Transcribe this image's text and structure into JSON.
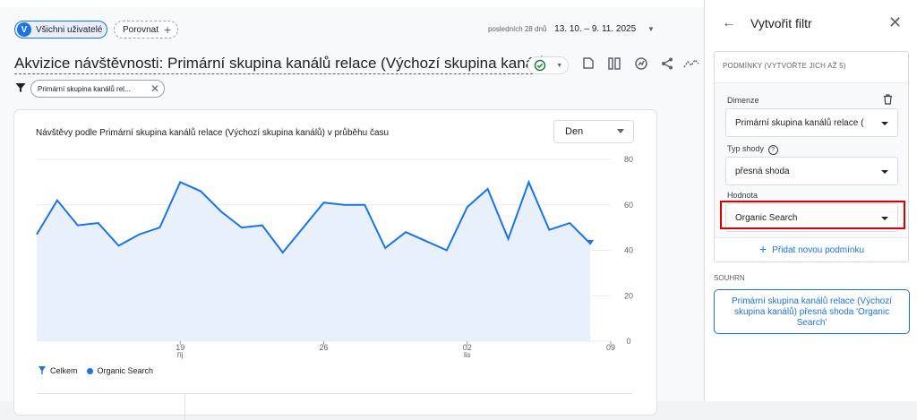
{
  "toolbar": {
    "all_users_initial": "V",
    "all_users_label": "Všichni uživatelé",
    "compare_label": "Porovnat",
    "date_prefix": "posledních 28 dnů",
    "date_range": "13. 10. – 9. 11. 2025"
  },
  "report": {
    "title": "Akvizice návštěvnosti: Primární skupina kanálů relace (Výchozí skupina kanálů)",
    "filter_chip": "Primární skupina kanálů rel..."
  },
  "chart": {
    "granularity": "Den"
  },
  "chart_data": {
    "type": "area",
    "title": "Návštěvy podle Primární skupina kanálů relace (Výchozí skupina kanálů) v průběhu času",
    "x_ticks": [
      {
        "day": 7,
        "label": "19",
        "sublabel": "říj"
      },
      {
        "day": 14,
        "label": "26",
        "sublabel": ""
      },
      {
        "day": 21,
        "label": "02",
        "sublabel": "lis"
      },
      {
        "day": 28,
        "label": "09",
        "sublabel": ""
      }
    ],
    "y_ticks": [
      0,
      20,
      40,
      60,
      80
    ],
    "ylim": [
      0,
      80
    ],
    "xlim": [
      0,
      28
    ],
    "series": [
      {
        "name": "Organic Search",
        "color": "#1a73e8",
        "values": [
          47,
          62,
          51,
          52,
          42,
          47,
          50,
          70,
          66,
          57,
          50,
          51,
          39,
          50,
          61,
          60,
          60,
          41,
          48,
          44,
          40,
          59,
          67,
          45,
          70,
          49,
          52,
          43
        ]
      }
    ],
    "legend": [
      {
        "label": "Celkem",
        "marker": "pin",
        "color": "#1a73e8"
      },
      {
        "label": "Organic Search",
        "marker": "dot",
        "color": "#1a73e8"
      }
    ]
  },
  "panel": {
    "title": "Vytvořit filtr",
    "conditions_label": "PODMÍNKY (VYTVOŘTE JICH AŽ 5)",
    "dimension_label": "Dimenze",
    "dimension_value": "Primární skupina kanálů relace (",
    "match_label": "Typ shody",
    "match_value": "přesná shoda",
    "value_label": "Hodnota",
    "value_value": "Organic Search",
    "add_condition": "Přidat novou podmínku",
    "summary_label": "SOUHRN",
    "summary_text": "Primární skupina kanálů relace (Výchozí skupina kanálů) přesná shoda 'Organic Search'"
  }
}
